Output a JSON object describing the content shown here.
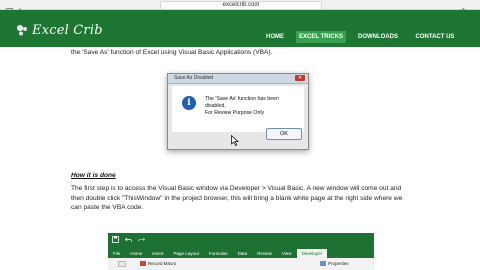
{
  "browser": {
    "url": "excelcrib.com"
  },
  "site": {
    "logo_text": "Excel Crib",
    "nav": [
      {
        "label": "HOME"
      },
      {
        "label": "EXCEL TRICKS"
      },
      {
        "label": "DOWNLOADS"
      },
      {
        "label": "CONTACT US"
      }
    ]
  },
  "article": {
    "partial_line": "the 'Save As' function of Excel using Visual Basic Applications (VBA).",
    "dialog": {
      "title": "Save As Disabled",
      "message_line1": "The 'Save As' function has been disabled.",
      "message_line2": "For Review Purpose Only",
      "ok_label": "OK"
    },
    "section_heading": "How it is done",
    "section_text": "The first step is to access the Visual Basic window via Developer > Visual Basic. A new window will come out and then double click \"ThisWindow\" in the project browser, this will bring a blank white page at the right side where we can paste the VBA code."
  },
  "excel_ribbon": {
    "tabs": [
      "File",
      "Home",
      "Insert",
      "Page Layout",
      "Formulas",
      "Data",
      "Review",
      "View",
      "Developer"
    ],
    "active_tab": "Developer",
    "record_macro": "Record Macro",
    "properties": "Properties"
  },
  "colors": {
    "nav_green": "#1d7733",
    "nav_active": "#38a14f",
    "dialog_icon": "#1f5fb5"
  }
}
